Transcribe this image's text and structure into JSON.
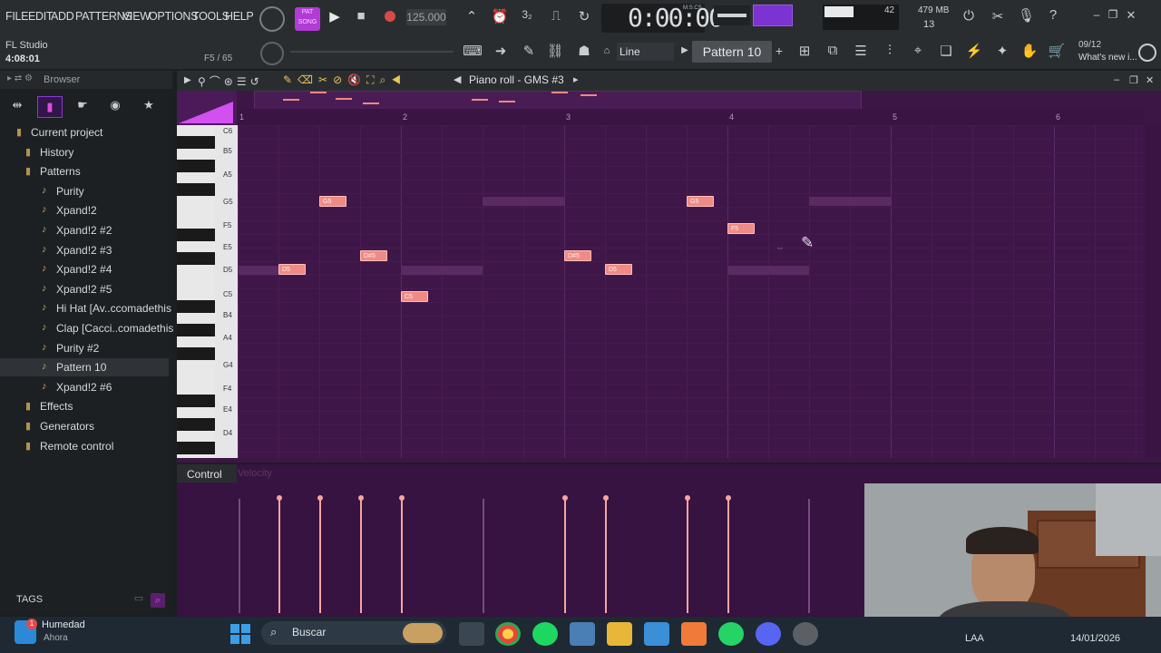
{
  "menu": [
    "FILE",
    "EDIT",
    "ADD",
    "PATTERNS",
    "VIEW",
    "OPTIONS",
    "TOOLS",
    "HELP"
  ],
  "app": {
    "name": "FL Studio",
    "time": "4:08:01",
    "hint_pos": "F5 / 65"
  },
  "transport": {
    "mode_label": "PAT\nSONG",
    "tempo": "125.000",
    "clock": "0:00:00",
    "clock_unit": "M:S:CS",
    "cpu": "42",
    "mem": "479 MB",
    "poly": "13"
  },
  "toolbar2": {
    "snap": "Line",
    "pattern": "Pattern 10",
    "news_date": "09/12",
    "news_text": "What's new i..."
  },
  "browser": {
    "title": "Browser",
    "tree": [
      {
        "label": "Current project",
        "kind": "folder"
      },
      {
        "label": "History",
        "kind": "folder"
      },
      {
        "label": "Patterns",
        "kind": "folder"
      },
      {
        "label": "Purity",
        "kind": "pattern"
      },
      {
        "label": "Xpand!2",
        "kind": "pattern"
      },
      {
        "label": "Xpand!2 #2",
        "kind": "pattern"
      },
      {
        "label": "Xpand!2 #3",
        "kind": "pattern"
      },
      {
        "label": "Xpand!2 #4",
        "kind": "pattern"
      },
      {
        "label": "Xpand!2 #5",
        "kind": "pattern"
      },
      {
        "label": "Hi Hat [Av..ccomadethis",
        "kind": "pattern"
      },
      {
        "label": "Clap [Cacci..comadethis",
        "kind": "pattern"
      },
      {
        "label": "Purity #2",
        "kind": "pattern"
      },
      {
        "label": "Pattern 10",
        "kind": "pattern"
      },
      {
        "label": "Xpand!2 #6",
        "kind": "pattern"
      },
      {
        "label": "Effects",
        "kind": "folder"
      },
      {
        "label": "Generators",
        "kind": "folder"
      },
      {
        "label": "Remote control",
        "kind": "folder"
      }
    ],
    "tags": "TAGS"
  },
  "pianoroll": {
    "title": "Piano roll - GMS #3",
    "ruler": [
      "2",
      "3",
      "4",
      "5",
      "6"
    ],
    "key_labels": [
      "C6",
      "B5",
      "A5",
      "G5",
      "F5",
      "E5",
      "D5",
      "C5",
      "B4",
      "A4",
      "G4",
      "F4",
      "E4",
      "D4"
    ],
    "notes": [
      "G5",
      "D#5",
      "D5",
      "C5",
      "D#5",
      "D5",
      "G5",
      "F5"
    ],
    "control_label": "Control",
    "control_sub": "Velocity"
  },
  "taskbar": {
    "weather_title": "Humedad",
    "weather_sub": "Ahora",
    "search": "Buscar",
    "lang": "LAA",
    "date": "14/01/2026",
    "badge": "1"
  },
  "colors": {
    "note": "#f08a84",
    "grid": "#3f1648",
    "accent": "#b23bd6"
  }
}
